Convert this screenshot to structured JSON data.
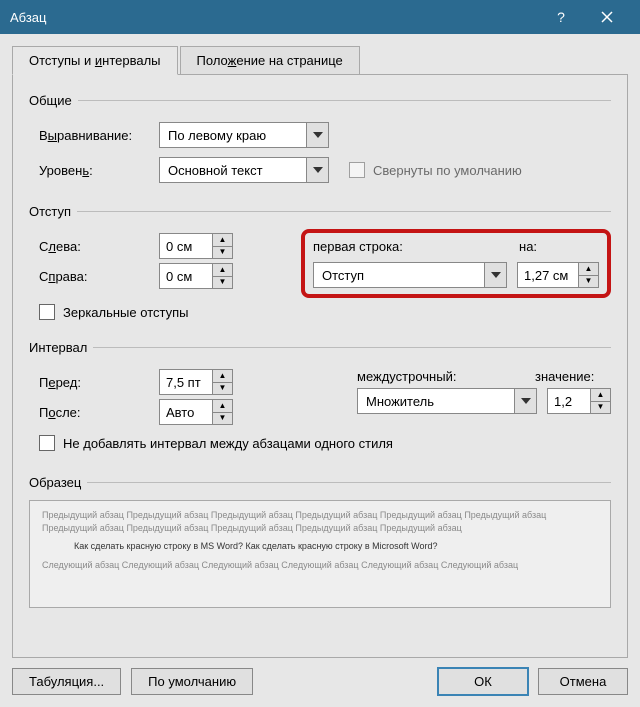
{
  "title": "Абзац",
  "tabs": {
    "tab1_pre": "Отступы и ",
    "tab1_ul": "и",
    "tab1_post": "нтервалы",
    "tab2_pre": "Поло",
    "tab2_ul": "ж",
    "tab2_post": "ение на странице"
  },
  "general": {
    "group": "Общие",
    "alignment_pre": "В",
    "alignment_ul": "ы",
    "alignment_post": "равнивание:",
    "alignment_value": "По левому краю",
    "outline_pre": "Уровен",
    "outline_ul": "ь",
    "outline_post": ":",
    "outline_value": "Основной текст",
    "collapsed": "Свернуты по умолчанию"
  },
  "indent": {
    "group": "Отступ",
    "left_pre": "С",
    "left_ul": "л",
    "left_post": "ева:",
    "left_value": "0 см",
    "right_pre": "С",
    "right_ul": "п",
    "right_post": "рава:",
    "right_value": "0 см",
    "first_pre": "перва",
    "first_ul": "я",
    "first_post": " строка:",
    "first_value": "Отступ",
    "by_pre": "",
    "by_ul": "н",
    "by_post": "а:",
    "by_value": "1,27 см",
    "mirror_pre": "",
    "mirror_ul": "З",
    "mirror_post": "еркальные отступы"
  },
  "spacing": {
    "group": "Интервал",
    "before_pre": "П",
    "before_ul": "е",
    "before_post": "ред:",
    "before_value": "7,5 пт",
    "after_pre": "П",
    "after_ul": "о",
    "after_post": "сле:",
    "after_value": "Авто",
    "line_pre": "",
    "line_ul": "м",
    "line_post": "еждустрочный:",
    "line_value": "Множитель",
    "at_pre": "",
    "at_ul": "з",
    "at_post": "начение:",
    "at_value": "1,2",
    "dont_add_pre": "Не до",
    "dont_add_ul": "б",
    "dont_add_post": "авлять интервал между абзацами одного стиля"
  },
  "preview": {
    "group": "Образец",
    "prev_para": "Предыдущий абзац Предыдущий абзац Предыдущий абзац Предыдущий абзац Предыдущий абзац Предыдущий абзац Предыдущий абзац Предыдущий абзац Предыдущий абзац Предыдущий абзац Предыдущий абзац",
    "main_para": "Как сделать красную строку в MS Word? Как сделать красную строку в Microsoft Word?",
    "next_para": "Следующий абзац Следующий абзац Следующий абзац Следующий абзац Следующий абзац Следующий абзац"
  },
  "footer": {
    "tabs_pre": "",
    "tabs_ul": "Т",
    "tabs_post": "абуляция...",
    "default": "По умолчанию",
    "ok": "ОК",
    "cancel": "Отмена"
  }
}
